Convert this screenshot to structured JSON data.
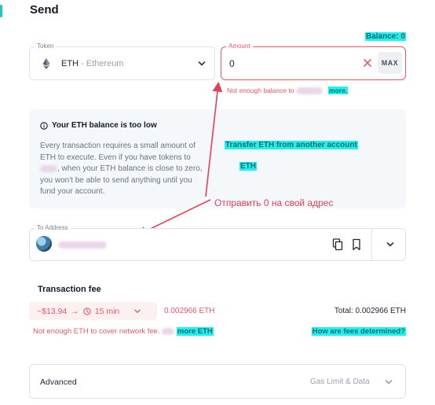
{
  "page": {
    "title": "Send"
  },
  "balance": {
    "label": "Balance: 0"
  },
  "token": {
    "label": "Token",
    "symbol": "ETH",
    "separator": " - ",
    "name": "Ethereum"
  },
  "amount": {
    "label": "Amount",
    "value": "0",
    "max_label": "MAX",
    "error_prefix": "Not enough balance to",
    "error_link": "more."
  },
  "info": {
    "title": "Your ETH balance is too low",
    "body_1": "Every transaction requires a small amount of ETH to execute. Even if you have tokens to",
    "body_2": ", when your ETH balance is close to zero, you won't be able to send anything until you fund your account.",
    "link_transfer": "Transfer ETH from another account",
    "link_eth": "ETH"
  },
  "annotation": {
    "text": "Отправить 0 на свой адрес"
  },
  "address": {
    "label": "To Address"
  },
  "fee": {
    "title": "Transaction fee",
    "usd": "~$13.94",
    "arrow": "→",
    "time": "15 min",
    "eth": "0.002966 ETH",
    "total": "Total:  0.002966 ETH",
    "error_prefix": "Not enough ETH to cover network fee.",
    "error_suffix": "more ETH",
    "fees_link": "How are fees determined?"
  },
  "advanced": {
    "label": "Advanced",
    "hint": "Gas Limit & Data"
  },
  "colors": {
    "accent": "#1ec8c0",
    "error": "#e8576a",
    "highlight": "#22f0ee",
    "annotation": "#e23f58"
  },
  "icons": [
    "ethereum-icon",
    "chevron-down-icon",
    "close-icon",
    "info-icon",
    "copy-icon",
    "bookmark-icon",
    "clock-icon"
  ]
}
